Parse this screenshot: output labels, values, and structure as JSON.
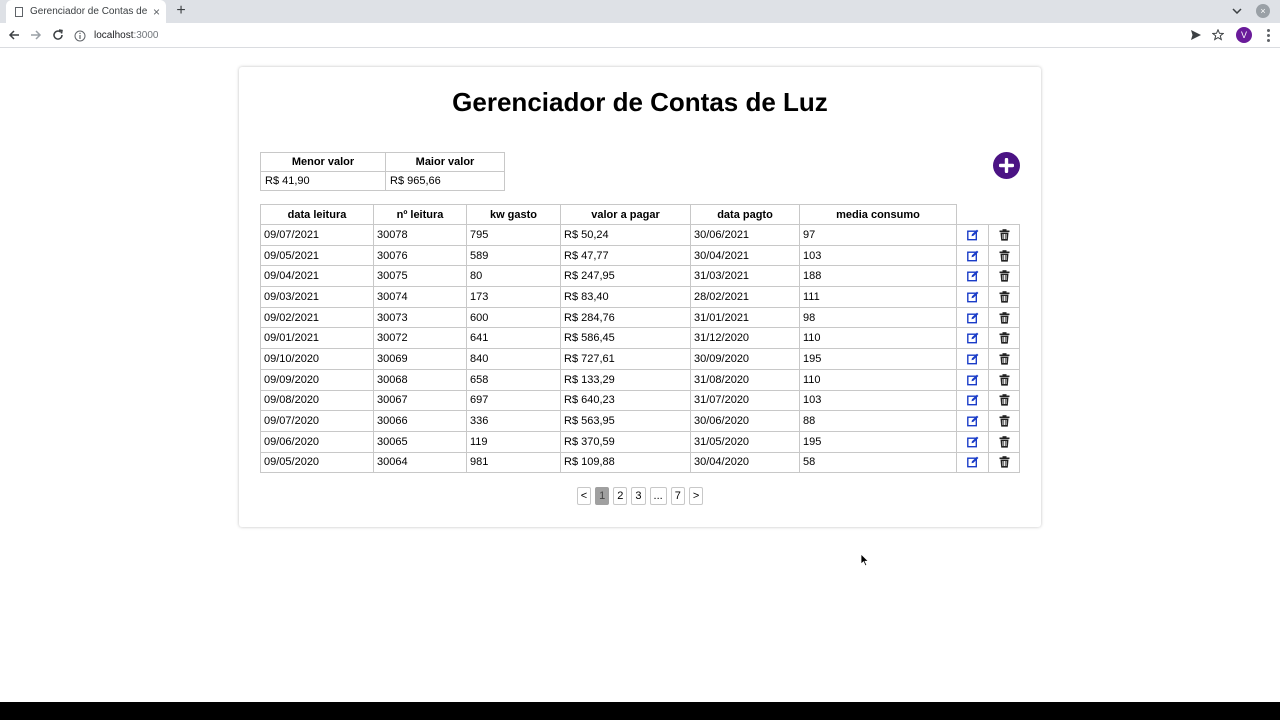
{
  "browser": {
    "tab_title": "Gerenciador de Contas de Luz",
    "tab_close": "×",
    "new_tab": "+",
    "url_host": "localhost",
    "url_port": ":3000",
    "avatar_letter": "V",
    "window_close": "×"
  },
  "page": {
    "title": "Gerenciador de Contas de Luz"
  },
  "summary": {
    "headers": [
      "Menor valor",
      "Maior valor"
    ],
    "values": [
      "R$ 41,90",
      "R$ 965,66"
    ]
  },
  "table": {
    "headers": [
      "data leitura",
      "nº leitura",
      "kw gasto",
      "valor a pagar",
      "data pagto",
      "media consumo"
    ],
    "rows": [
      [
        "09/07/2021",
        "30078",
        "795",
        "R$ 50,24",
        "30/06/2021",
        "97"
      ],
      [
        "09/05/2021",
        "30076",
        "589",
        "R$ 47,77",
        "30/04/2021",
        "103"
      ],
      [
        "09/04/2021",
        "30075",
        "80",
        "R$ 247,95",
        "31/03/2021",
        "188"
      ],
      [
        "09/03/2021",
        "30074",
        "173",
        "R$ 83,40",
        "28/02/2021",
        "111"
      ],
      [
        "09/02/2021",
        "30073",
        "600",
        "R$ 284,76",
        "31/01/2021",
        "98"
      ],
      [
        "09/01/2021",
        "30072",
        "641",
        "R$ 586,45",
        "31/12/2020",
        "110"
      ],
      [
        "09/10/2020",
        "30069",
        "840",
        "R$ 727,61",
        "30/09/2020",
        "195"
      ],
      [
        "09/09/2020",
        "30068",
        "658",
        "R$ 133,29",
        "31/08/2020",
        "110"
      ],
      [
        "09/08/2020",
        "30067",
        "697",
        "R$ 640,23",
        "31/07/2020",
        "103"
      ],
      [
        "09/07/2020",
        "30066",
        "336",
        "R$ 563,95",
        "30/06/2020",
        "88"
      ],
      [
        "09/06/2020",
        "30065",
        "119",
        "R$ 370,59",
        "31/05/2020",
        "195"
      ],
      [
        "09/05/2020",
        "30064",
        "981",
        "R$ 109,88",
        "30/04/2020",
        "58"
      ]
    ]
  },
  "pagination": {
    "prev": "<",
    "pages": [
      "1",
      "2",
      "3",
      "...",
      "7"
    ],
    "next": ">",
    "active": "1"
  },
  "colors": {
    "accent": "#4b1384",
    "edit_icon": "#1a3cc8",
    "trash_icon": "#222222"
  },
  "icons": {
    "edit": "edit-icon",
    "delete": "trash-icon",
    "add": "plus-circle-icon"
  }
}
